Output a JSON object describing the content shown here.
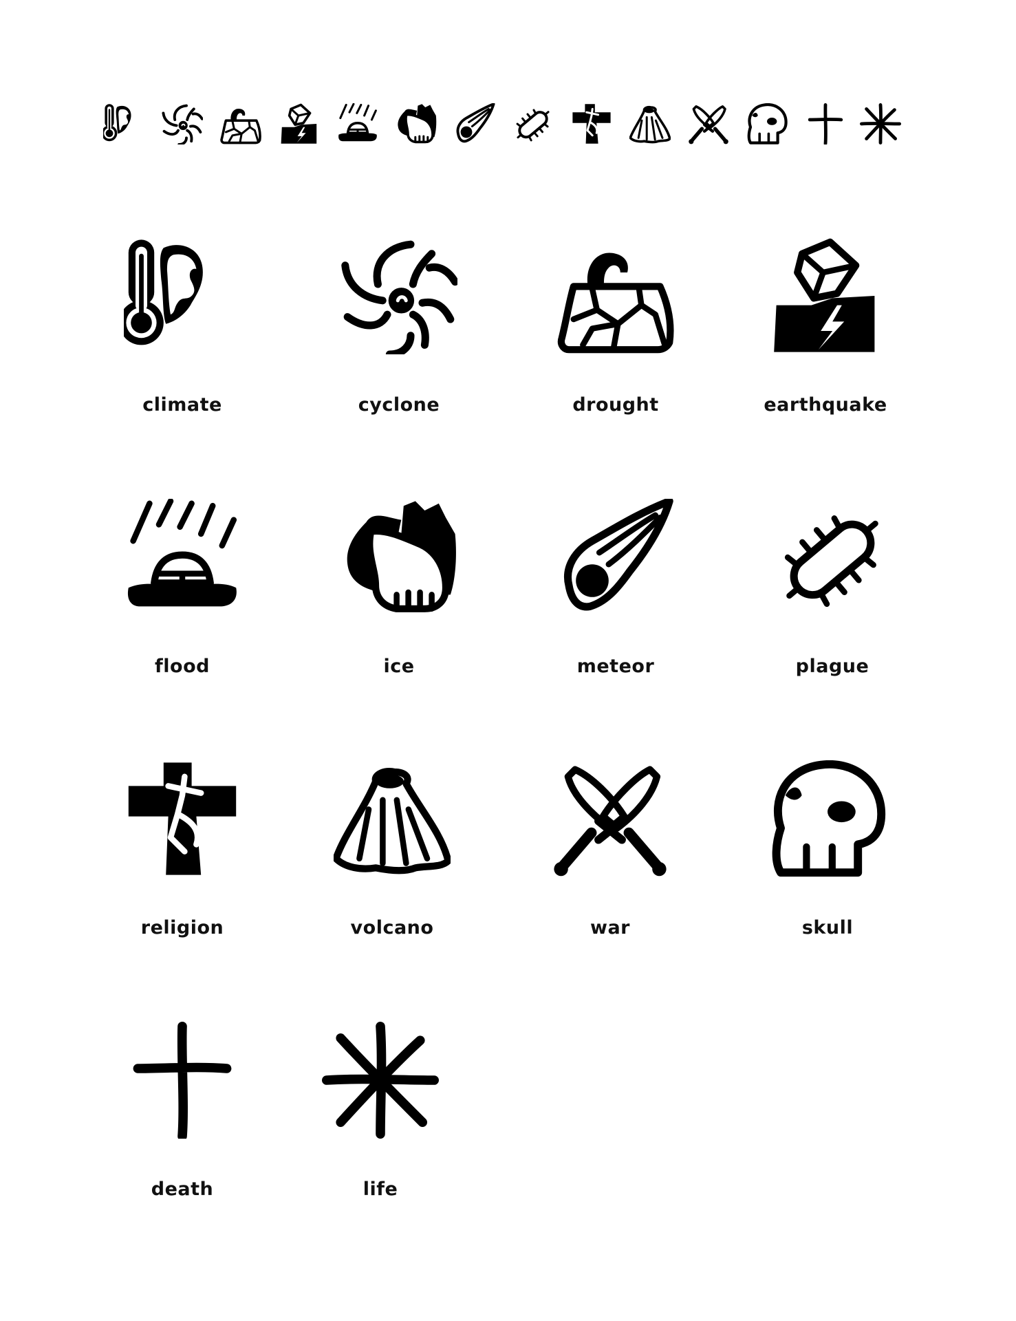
{
  "ink_color": "#000000",
  "background_color": "#ffffff",
  "icon_strip": [
    "climate-icon",
    "cyclone-icon",
    "drought-icon",
    "earthquake-icon",
    "flood-icon",
    "ice-icon",
    "meteor-icon",
    "plague-icon",
    "religion-icon",
    "volcano-icon",
    "war-icon",
    "skull-icon",
    "death-icon",
    "life-icon"
  ],
  "icons": [
    {
      "label": "climate",
      "icon": "climate-icon"
    },
    {
      "label": "cyclone",
      "icon": "cyclone-icon"
    },
    {
      "label": "drought",
      "icon": "drought-icon"
    },
    {
      "label": "earthquake",
      "icon": "earthquake-icon"
    },
    {
      "label": "flood",
      "icon": "flood-icon"
    },
    {
      "label": "ice",
      "icon": "ice-icon"
    },
    {
      "label": "meteor",
      "icon": "meteor-icon"
    },
    {
      "label": "plague",
      "icon": "plague-icon"
    },
    {
      "label": "religion",
      "icon": "religion-icon"
    },
    {
      "label": "volcano",
      "icon": "volcano-icon"
    },
    {
      "label": "war",
      "icon": "war-icon"
    },
    {
      "label": "skull",
      "icon": "skull-icon"
    },
    {
      "label": "death",
      "icon": "death-icon"
    },
    {
      "label": "life",
      "icon": "life-icon"
    }
  ]
}
